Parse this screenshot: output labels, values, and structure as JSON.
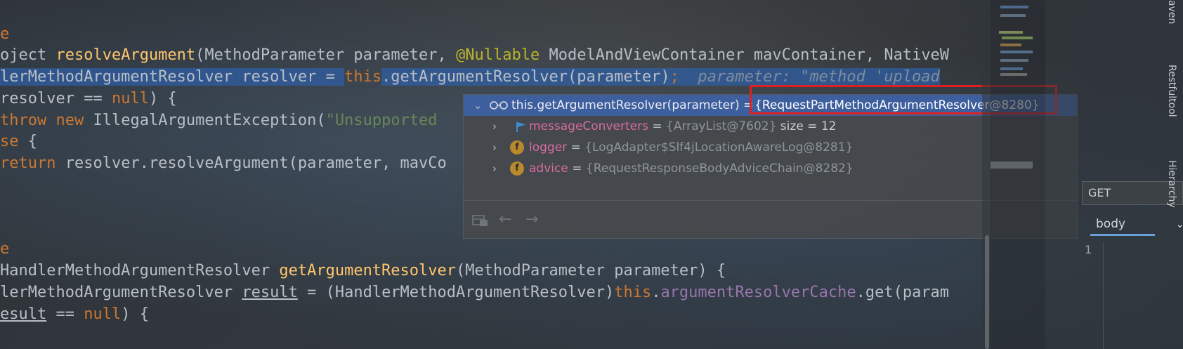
{
  "code": {
    "l1": "e",
    "l2": {
      "t1": "oject ",
      "fn": "resolveArgument",
      "t2": "(MethodParameter parameter, ",
      "an": "@Nullable",
      "t3": " ModelAndViewContainer mavContainer, NativeW"
    },
    "l3": {
      "t1": "lerMethodArgumentResolver resolver = ",
      "kw": "this",
      "t2": ".getArgumentResolver(parameter)",
      "semi": ";",
      "cm": "  parameter: \"method 'upload"
    },
    "l4": {
      "t1": "resolver == ",
      "kw": "null",
      "t2": ") {"
    },
    "l5": {
      "kw1": "throw",
      "sp": " ",
      "kw2": "new",
      "t1": " IllegalArgumentException(",
      "st": "\"Unsupported"
    },
    "l6": {
      "kw": "se",
      "t1": " {"
    },
    "l7": {
      "kw": "return",
      "t1": " resolver.resolveArgument(parameter, mavCo"
    },
    "l8": "e",
    "l9": {
      "t1": "HandlerMethodArgumentResolver ",
      "fn": "getArgumentResolver",
      "t2": "(MethodParameter parameter) {"
    },
    "l10": {
      "t1": "lerMethodArgumentResolver ",
      "u": "result",
      "t2": " = (HandlerMethodArgumentResolver)",
      "kw": "this",
      "t3": ".",
      "fd": "argumentResolverCache",
      "t4": ".get(param"
    },
    "l11": {
      "u": "esult",
      "t1": " == ",
      "kw": "null",
      "t2": ") {"
    }
  },
  "popup": {
    "header": {
      "icon": "watch-glasses-icon",
      "expr": "this.getArgumentResolver(parameter) = ",
      "value": "{RequestPartMethodArgumentResolver@8280}"
    },
    "items": [
      {
        "icon": "flag-icon",
        "name": "messageConverters",
        "eq": " = ",
        "value": "{ArrayList@7602}",
        "extra": "  size = 12"
      },
      {
        "icon": "field-icon",
        "badge": "f",
        "name": "logger",
        "eq": " = ",
        "value": "{LogAdapter$Slf4jLocationAwareLog@8281}",
        "extra": ""
      },
      {
        "icon": "field-icon",
        "badge": "f",
        "name": "advice",
        "eq": " = ",
        "value": "{RequestResponseBodyAdviceChain@8282}",
        "extra": ""
      }
    ],
    "toolbar": [
      "pin-to-tree-icon",
      "back-arrow-icon",
      "forward-arrow-icon"
    ]
  },
  "right_panel": {
    "method": "GET",
    "body_tab": "body",
    "line_number": "1",
    "side_tabs": [
      "aven",
      "Restfultool",
      "Hierarchy"
    ]
  },
  "colors": {
    "selection": "#3e5f9e",
    "highlight_box": "#e02020",
    "keyword": "#cc7832",
    "method": "#ffc66d",
    "annotation": "#bbb529",
    "string": "#6a8759",
    "field": "#9876aa",
    "var_name": "#d86ca0"
  }
}
